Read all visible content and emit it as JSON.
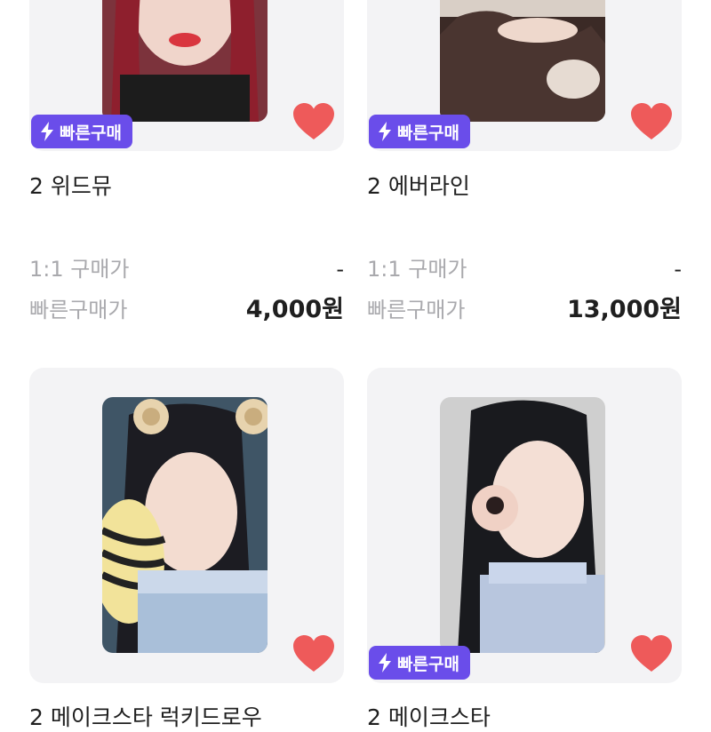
{
  "products": [
    {
      "badge": "빠른구매",
      "title": "2 위드뮤",
      "direct_label": "1:1 구매가",
      "direct_value": "-",
      "quick_label": "빠른구매가",
      "quick_value": "4,000원",
      "photo_desc": "photocard-red-hair"
    },
    {
      "badge": "빠른구매",
      "title": "2 에버라인",
      "direct_label": "1:1 구매가",
      "direct_value": "-",
      "quick_label": "빠른구매가",
      "quick_value": "13,000원",
      "photo_desc": "photocard-hands-pose"
    },
    {
      "title": "2 메이크스타 럭키드로우",
      "photo_desc": "photocard-bear-ears"
    },
    {
      "badge": "빠른구매",
      "title": "2 메이크스타",
      "photo_desc": "photocard-ok-sign"
    }
  ],
  "colors": {
    "accent": "#6a4dea",
    "heart": "#ee5a5a",
    "card_bg": "#f3f3f5",
    "muted_text": "#a9a9ad"
  },
  "icons": {
    "badge_icon": "lightning-bolt-icon",
    "favorite_icon": "heart-icon"
  }
}
